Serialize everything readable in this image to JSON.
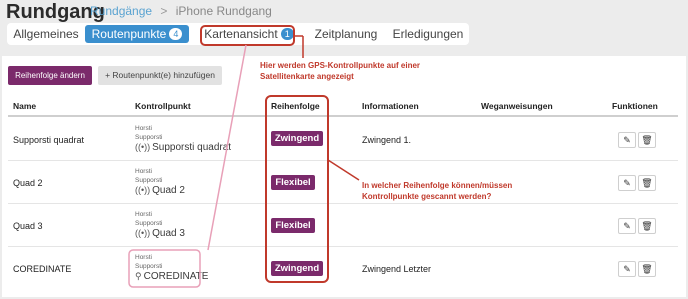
{
  "page": {
    "title": "Rundgang"
  },
  "breadcrumb": {
    "link": "Rundgänge",
    "separator": ">",
    "current": "iPhone Rundgang"
  },
  "tabs": [
    {
      "label": "Allgemeines"
    },
    {
      "label": "Routenpunkte",
      "badge": "4"
    },
    {
      "label": "Kartenansicht",
      "badge": "1"
    },
    {
      "label": "Zeitplanung"
    },
    {
      "label": "Erledigungen"
    }
  ],
  "toolbar": {
    "reorder_label": "Reihenfolge ändern",
    "add_label": "+ Routenpunkt(e) hinzufügen"
  },
  "table": {
    "headers": {
      "name": "Name",
      "checkpoint": "Kontrollpunkt",
      "order": "Reihenfolge",
      "info": "Informationen",
      "directions": "Weganweisungen",
      "functions": "Funktionen"
    },
    "rows": [
      {
        "name": "Supporsti quadrat",
        "line1": "Horsti",
        "line2": "Supporsti",
        "checkpoint": "Supporsti quadrat",
        "checkpoint_icon": "nfc-icon",
        "order": "Zwingend",
        "info": "Zwingend 1."
      },
      {
        "name": "Quad 2",
        "line1": "Horsti",
        "line2": "Supporsti",
        "checkpoint": "Quad 2",
        "checkpoint_icon": "nfc-icon",
        "order": "Flexibel",
        "info": ""
      },
      {
        "name": "Quad 3",
        "line1": "Horsti",
        "line2": "Supporsti",
        "checkpoint": "Quad 3",
        "checkpoint_icon": "nfc-icon",
        "order": "Flexibel",
        "info": ""
      },
      {
        "name": "COREDINATE",
        "line1": "Horsti",
        "line2": "Supporsti",
        "checkpoint": "COREDINATE",
        "checkpoint_icon": "map-pin-icon",
        "order": "Zwingend",
        "info": "Zwingend Letzter"
      }
    ]
  },
  "annotations": {
    "map": "Hier werden GPS-Kontrollpunkte auf einer Satellitenkarte angezeigt",
    "order": "In welcher Reihenfolge können/müssen Kontrollpunkte gescannt werden?"
  },
  "icons": {
    "edit": "pencil-icon",
    "delete": "trash-icon"
  },
  "colors": {
    "accent": "#3a8fce",
    "purple": "#7b2a6b",
    "annotation": "#c0392b",
    "highlight_pink": "#e8a0b8"
  }
}
